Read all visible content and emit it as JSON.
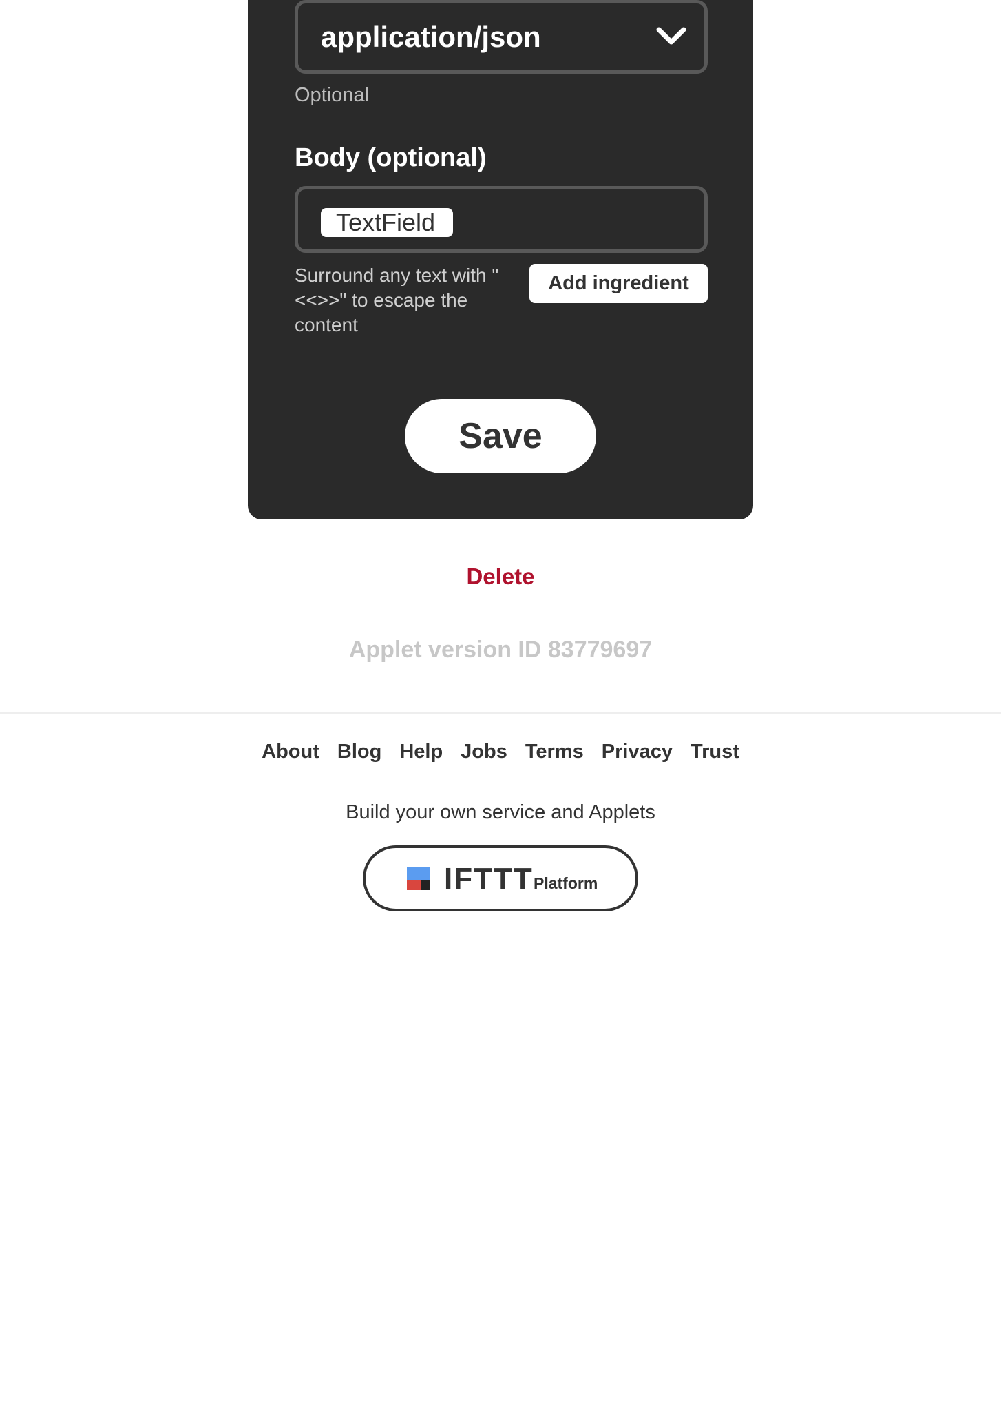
{
  "form": {
    "content_type": {
      "selected": "application/json",
      "helper": "Optional"
    },
    "body": {
      "label": "Body (optional)",
      "ingredient_chip": "TextField",
      "helper": "Surround any text with \"<<>>\" to escape the content",
      "add_ingredient_label": "Add ingredient"
    },
    "save_label": "Save"
  },
  "delete_label": "Delete",
  "version_text": "Applet version ID 83779697",
  "footer": {
    "nav": [
      "About",
      "Blog",
      "Help",
      "Jobs",
      "Terms",
      "Privacy",
      "Trust"
    ],
    "build_text": "Build your own service and Applets",
    "platform_button": {
      "brand": "IFTTT",
      "suffix": "Platform"
    }
  },
  "colors": {
    "card_bg": "#2a2a2a",
    "delete": "#b0122e",
    "logo_blue": "#5b9cf0",
    "logo_red": "#d9463e",
    "logo_dark": "#222222"
  }
}
